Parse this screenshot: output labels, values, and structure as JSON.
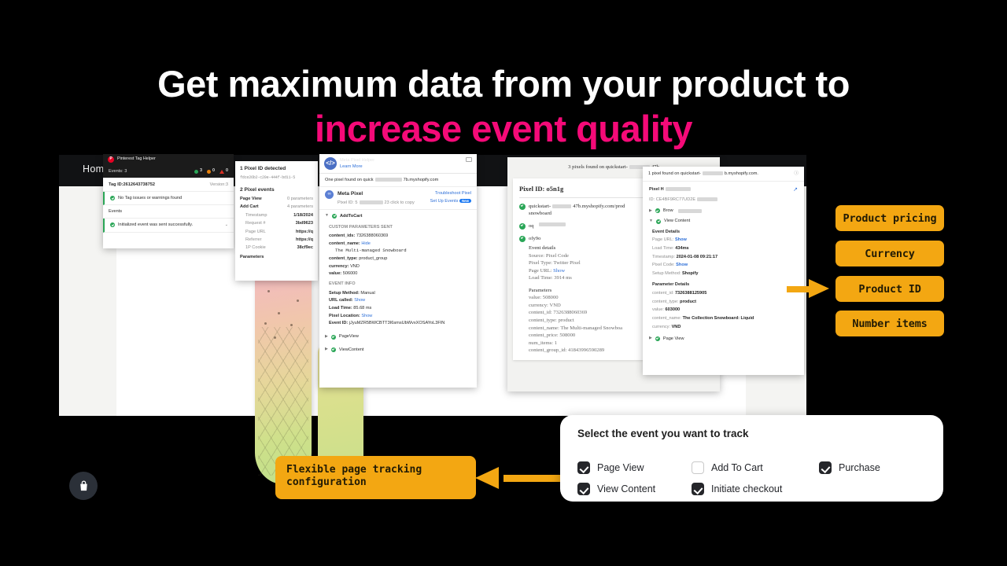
{
  "headline": {
    "line1": "Get maximum data from your product to",
    "line2": "increase event quality",
    "white": "#FFFFFF",
    "accent": "#F50A78"
  },
  "store": {
    "nav_home": "Home"
  },
  "pinterest_panel": {
    "title": "Pinterest Tag Helper",
    "events_count": "Events: 3",
    "count_ok": "3",
    "count_warn": "0",
    "count_err": "0",
    "tag_id": "Tag ID:2612643738752",
    "version": "Version:3",
    "status": "No Tag issues or warnings found",
    "events_label": "Events",
    "event_item": "Initialized event was sent successfully."
  },
  "pixel_panel": {
    "detected": "1 Pixel ID detected",
    "pixel_hash": "fdce26b2-c20e-444f-bd11-5",
    "events_title": "2 Pixel events",
    "event_1": "Page View",
    "event_1_params": "0 parameters",
    "event_2": "Add Cart",
    "event_2_params": "4 parameters",
    "rows": [
      {
        "key": "Timestamp",
        "value": "1/18/2024"
      },
      {
        "key": "Request #",
        "value": "3bd9623"
      },
      {
        "key": "Page URL",
        "value": "https://q"
      },
      {
        "key": "Referrer",
        "value": "https://q"
      },
      {
        "key": "1P Cookie",
        "value": "38cf9ec"
      }
    ],
    "params_label": "Parameters"
  },
  "meta_panel": {
    "app_title": "Meta Pixel Helper",
    "learn_more": "Learn More",
    "found": "One pixel found on quick",
    "found_tail": "7b.myshopify.com",
    "pixel_name": "Meta Pixel",
    "pixel_id_prefix": "Pixel ID: 5",
    "pixel_id_suffix": "23 click to copy",
    "troubleshoot": "Troubleshoot Pixel",
    "setup_events": "Set Up Events",
    "new_badge": "New",
    "event_name": "AddToCart",
    "custom_params_title": "CUSTOM PARAMETERS SENT",
    "content_ids_k": "content_ids:",
    "content_ids_v": "7326388060369",
    "content_name_k": "content_name:",
    "content_name_hide": "Hide",
    "content_name_v": "The Multi-managed Snowboard",
    "content_type_k": "content_type:",
    "content_type_v": "product_group",
    "currency_k": "currency:",
    "currency_v": "VND",
    "value_k": "value:",
    "value_v": "506000",
    "event_info_title": "EVENT INFO",
    "setup_method_k": "Setup Method:",
    "setup_method_v": "Manual",
    "url_called_k": "URL called:",
    "url_called_v": "Show",
    "load_time_k": "Load Time:",
    "load_time_v": "85.68 ms",
    "pixel_location_k": "Pixel Location:",
    "pixel_location_v": "Show",
    "event_id_k": "Event ID:",
    "event_id_v": "jJyuMZR5BWCBTT3I6smsUbWvxXOSAYoL3FIN",
    "collapsed_1": "PageView",
    "collapsed_2": "ViewContent"
  },
  "twitter_panel": {
    "found": "3 pixels found on quickstart-",
    "found_tail": "47b",
    "pixel_id": "Pixel ID: o5n1g",
    "event_1": "quickstart-",
    "event_1_tail": "47b.myshopify.com/prod",
    "event_1_line2": "snowboard",
    "event_2": "oq",
    "event_3": "ofy9o",
    "details_title": "Event details",
    "source_k": "Source:",
    "source_v": "Pixel Code",
    "pixel_type_k": "Pixel Type:",
    "pixel_type_v": "Twitter Pixel",
    "page_url_k": "Page URL:",
    "page_url_v": "Show",
    "load_time_k": "Load Time:",
    "load_time_v": "3914 ms",
    "params_title": "Parameters",
    "params": [
      {
        "key": "value:",
        "value": "508000"
      },
      {
        "key": "currency:",
        "value": "VND"
      },
      {
        "key": "content_id:",
        "value": "7326388060369"
      },
      {
        "key": "content_type:",
        "value": "product"
      },
      {
        "key": "content_name:",
        "value": "The Multi-managed Snowboa"
      },
      {
        "key": "content_price:",
        "value": "508000"
      },
      {
        "key": "num_items:",
        "value": "1"
      },
      {
        "key": "content_group_id:",
        "value": "41843996590289"
      }
    ]
  },
  "tiktok_panel": {
    "found": "1 pixel found on quickstart-",
    "found_tail": "b.myshopify.com.",
    "pixel_label": "Pixel H",
    "id_label": "ID:",
    "id_value": "CE4BF9RC77UD2E",
    "event_collapsed": "Brow",
    "event_open": "View Content",
    "details_title": "Event Details",
    "page_url_k": "Page URL:",
    "page_url_v": "Show",
    "load_time_k": "Load Time:",
    "load_time_v": "434ms",
    "timestamp_k": "Timestamp:",
    "timestamp_v": "2024-01-08 09:21:17",
    "pixel_code_k": "Pixel Code:",
    "pixel_code_v": "Show",
    "setup_method_k": "Setup Method:",
    "setup_method_v": "Shopify",
    "params_title": "Parameter Details",
    "params": [
      {
        "key": "content_id:",
        "value": "7326388125905"
      },
      {
        "key": "content_type:",
        "value": "product"
      },
      {
        "key": "value:",
        "value": "603000"
      },
      {
        "key": "content_name:",
        "value": "The Collection Snowboard: Liquid"
      },
      {
        "key": "currency:",
        "value": "VND"
      }
    ],
    "footer_event": "Page View"
  },
  "badges": {
    "accent": "#F3A712",
    "items": [
      {
        "label": "Product pricing"
      },
      {
        "label": "Currency"
      },
      {
        "label": "Product ID"
      },
      {
        "label": "Number items"
      }
    ]
  },
  "callout": {
    "line1": "Flexible page tracking",
    "line2": "configuration"
  },
  "event_selector": {
    "title": "Select the event you want to track",
    "options": [
      {
        "label": "Page View",
        "checked": true
      },
      {
        "label": "Add To Cart",
        "checked": false
      },
      {
        "label": "Purchase",
        "checked": true
      },
      {
        "label": "View Content",
        "checked": true
      },
      {
        "label": "Initiate checkout",
        "checked": true
      }
    ]
  }
}
